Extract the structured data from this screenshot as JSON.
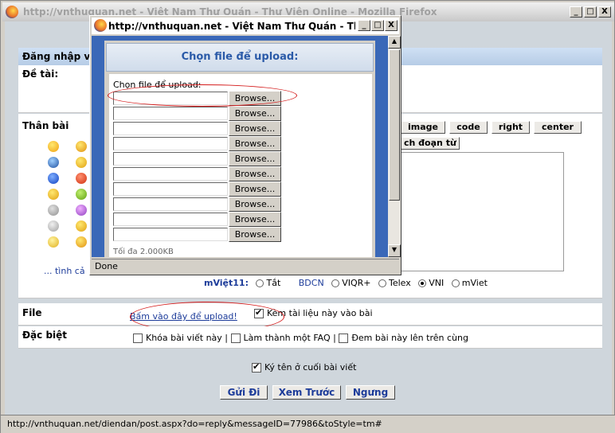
{
  "main_window": {
    "title": "http://vnthuquan.net - Việt Nam Thư Quán - Thư Viện Online - Mozilla Firefox",
    "controls": [
      "_",
      "□",
      "X"
    ]
  },
  "form": {
    "login_label": "Đăng nhập v",
    "subject_label": "Đề tài:",
    "body_label": "Thân bài",
    "more_smileys_link": "... tình cả",
    "format_buttons": [
      "image",
      "code",
      "right",
      "center"
    ],
    "format_button_row2": "ch đoạn từ",
    "typing": {
      "label": "mViệt11:",
      "options": [
        "Tắt",
        "BDCN",
        "VIQR+",
        "Telex",
        "VNI",
        "mViet"
      ],
      "selected": "VNI"
    },
    "file_label": "File",
    "upload_link": "Bấm vào đây để upload!",
    "attach_checkbox_label": "Kèm tài liệu này vào bài",
    "attach_checked": true,
    "special_label": "Đặc biệt",
    "special_options": [
      {
        "label": "Khóa bài viết này",
        "sep": "|"
      },
      {
        "label": "Làm thành một FAQ",
        "sep": "|"
      },
      {
        "label": "Đem bài này lên trên cùng",
        "sep": ""
      }
    ],
    "signature_label": "Ký tên ở cuối bài viết",
    "signature_checked": true,
    "buttons": [
      "Gửi Đi",
      "Xem Trước",
      "Ngưng"
    ]
  },
  "status_bar": "http://vnthuquan.net/diendan/post.aspx?do=reply&messageID=77986&toStyle=tm#",
  "popup": {
    "title": "http://vnthuquan.net - Việt Nam Thư Quán - Thư Viện ...",
    "controls": [
      "_",
      "□",
      "X"
    ],
    "header": "Chọn file để upload:",
    "choose_label": "Chọn file để upload:",
    "browse_label": "Browse...",
    "file_slots": 10,
    "footer_partial": "Tối đa 2.000KB",
    "status": "Done"
  },
  "colors": {
    "accent_blue": "#3a68b8",
    "highlight_red": "#d41a1a",
    "link_blue": "#1d3c9a"
  }
}
